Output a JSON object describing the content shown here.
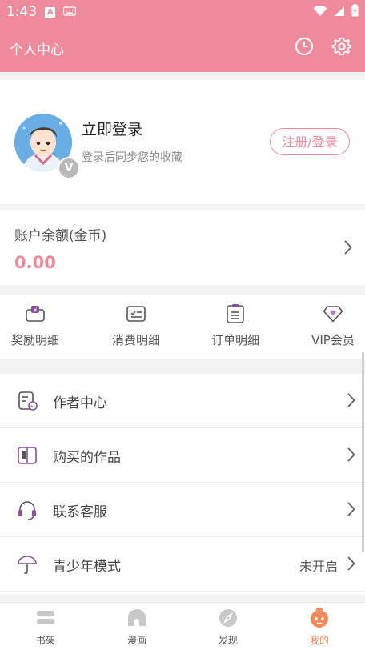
{
  "status_bar": {
    "time": "1:43",
    "notif_icon_1": "A"
  },
  "header": {
    "title": "个人中心",
    "history_icon": "clock-icon",
    "settings_icon": "gear-icon"
  },
  "user": {
    "login_title": "立即登录",
    "login_subtitle": "登录后同步您的收藏",
    "badge": "V",
    "register_login_button": "注册/登录"
  },
  "account": {
    "balance_label": "账户余额(金币)",
    "balance_value": "0.00"
  },
  "quick_links": [
    {
      "label": "奖励明细",
      "icon": "reward-icon"
    },
    {
      "label": "消费明细",
      "icon": "expense-icon"
    },
    {
      "label": "订单明细",
      "icon": "order-icon"
    },
    {
      "label": "VIP会员",
      "icon": "diamond-icon"
    }
  ],
  "menu": [
    {
      "label": "作者中心",
      "status": "",
      "icon": "author-icon"
    },
    {
      "label": "购买的作品",
      "status": "",
      "icon": "purchased-icon"
    },
    {
      "label": "联系客服",
      "status": "",
      "icon": "headset-icon"
    },
    {
      "label": "青少年模式",
      "status": "未开启",
      "icon": "umbrella-icon"
    }
  ],
  "bottom_nav": [
    {
      "label": "书架",
      "icon": "bookshelf-icon",
      "active": false
    },
    {
      "label": "漫画",
      "icon": "comic-icon",
      "active": false
    },
    {
      "label": "发现",
      "icon": "discover-icon",
      "active": false
    },
    {
      "label": "我的",
      "icon": "profile-icon",
      "active": true
    }
  ],
  "colors": {
    "accent": "#ef8a9c",
    "active_nav": "#f08a5d",
    "inactive_nav": "#c8c8c8",
    "icon_purple": "#8a4f9e"
  }
}
